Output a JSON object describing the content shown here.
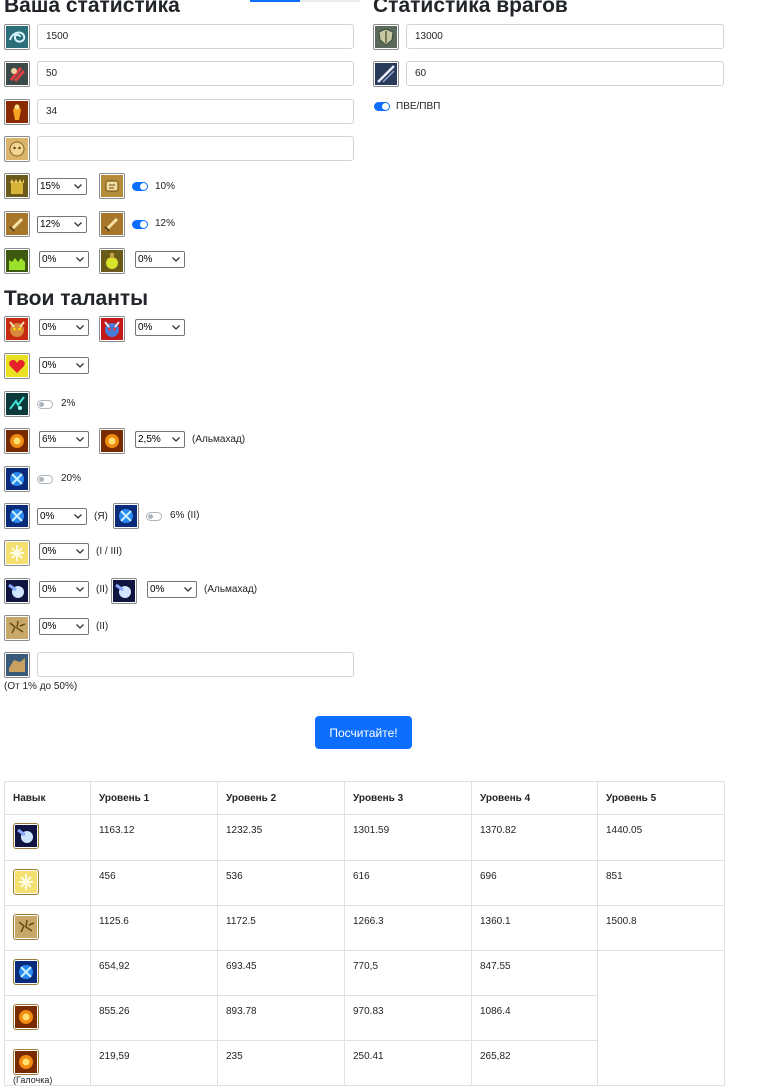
{
  "player": {
    "title": "Ваша статистика",
    "stat_values": [
      "1500",
      "50",
      "34",
      ""
    ]
  },
  "enemy": {
    "title": "Статистика врагов",
    "stat_values": [
      "13000",
      "60"
    ],
    "pve_pvp_label": "ПВЕ/ПВП"
  },
  "modifiers": {
    "row1": {
      "select": "15%",
      "toggle_label": "10%"
    },
    "row2": {
      "select": "12%",
      "toggle_label": "12%"
    },
    "row3": {
      "select_a": "0%",
      "select_b": "0%"
    }
  },
  "talents": {
    "title": "Твои таланты",
    "row1": {
      "select_a": "0%",
      "select_b": "0%"
    },
    "row2": {
      "select": "0%"
    },
    "row3": {
      "toggle_label": "2%"
    },
    "row4": {
      "select_a": "6%",
      "select_b": "2,5%",
      "note": "(Альмахад)"
    },
    "row5": {
      "toggle_label": "20%"
    },
    "row6": {
      "select": "0%",
      "note": "(Я)",
      "toggle_label": "6% (II)"
    },
    "row7": {
      "select": "0%",
      "note": "(I / III)"
    },
    "row8": {
      "select_a": "0%",
      "note_a": "(II)",
      "select_b": "0%",
      "note_b": "(Альмахад)"
    },
    "row9": {
      "select": "0%",
      "note": "(II)"
    },
    "row10": {
      "input_value": "",
      "hint": "(От 1% до 50%)"
    }
  },
  "calculate_button": "Посчитайте!",
  "results": {
    "headers": [
      "Навык",
      "Уровень 1",
      "Уровень 2",
      "Уровень 3",
      "Уровень 4",
      "Уровень 5"
    ],
    "rows": [
      {
        "icon": "frost-orb-icon",
        "values": [
          "1163.12",
          "1232.35",
          "1301.59",
          "1370.82",
          "1440.05"
        ]
      },
      {
        "icon": "holy-light-icon",
        "values": [
          "456",
          "536",
          "616",
          "696",
          "851"
        ]
      },
      {
        "icon": "earth-crack-icon",
        "values": [
          "1125.6",
          "1172.5",
          "1266.3",
          "1360.1",
          "1500.8"
        ]
      },
      {
        "icon": "lightning-orb-icon",
        "values": [
          "654,92",
          "693.45",
          "770,5",
          "847.55"
        ]
      },
      {
        "icon": "fire-fist-icon",
        "values": [
          "855.26",
          "893.78",
          "970.83",
          "1086.4"
        ]
      },
      {
        "icon": "fire-fist-icon",
        "values": [
          "219,59",
          "235",
          "250.41",
          "265,82"
        ],
        "note": "(Галочка)"
      }
    ]
  }
}
